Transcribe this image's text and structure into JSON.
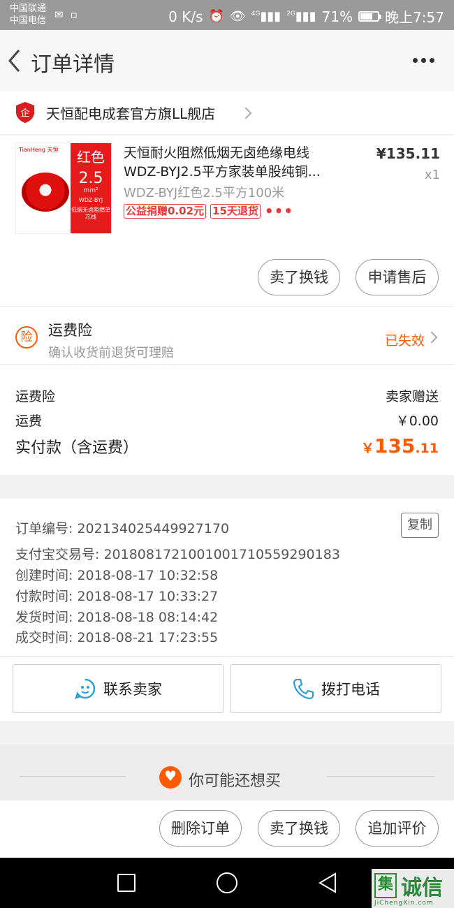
{
  "status_bar": {
    "carrier_1": "中国联通",
    "carrier_2": "中国电信",
    "speed": "0 K/s",
    "net_1": "4G",
    "net_2": "2G",
    "battery": "71%",
    "battery_level": 0.71,
    "time": "晚上7:57"
  },
  "header": {
    "title": "订单详情"
  },
  "store": {
    "name": "天恒配电成套官方旗LL舰店",
    "logo_text": "企"
  },
  "product": {
    "image": {
      "brand": "TianHeng 天恒",
      "color_text": "红色",
      "size_text": "2.5",
      "unit_text": "mm²",
      "model_text": "WDZ-BYJ",
      "desc_text": "低烟无卤阻燃单芯线"
    },
    "title_line1": "天恒耐火阻燃低烟无卤绝缘电线",
    "title_line2": "WDZ-BYJ2.5平方家装单股纯铜...",
    "sku": "WDZ-BYJ红色2.5平方100米",
    "tag_charity": "公益捐赠0.02元",
    "tag_return": "15天退货",
    "tag_more": "•••",
    "price": "¥135.11",
    "quantity": "x1",
    "btn_resell": "卖了换钱",
    "btn_aftersale": "申请售后"
  },
  "insurance": {
    "icon_text": "险",
    "title": "运费险",
    "subtitle": "确认收货前退货可理赔",
    "status": "已失效"
  },
  "costs": {
    "insurance_label": "运费险",
    "insurance_value": "卖家赠送",
    "shipping_label": "运费",
    "shipping_value": "￥0.00",
    "total_label": "实付款（含运费）",
    "total_currency": "￥",
    "total_int": "135",
    "total_dec": ".11"
  },
  "order_info": {
    "order_no": "订单编号: 202134025449927170",
    "copy": "复制",
    "alipay_no": "支付宝交易号: 2018081721001001710559290183",
    "created": "创建时间: 2018-08-17 10:32:58",
    "paid": "付款时间: 2018-08-17 10:33:27",
    "shipped": "发货时间: 2018-08-18 08:14:42",
    "completed": "成交时间: 2018-08-21 17:23:55"
  },
  "contact": {
    "seller": "联系卖家",
    "call": "拨打电话"
  },
  "recommend": {
    "title": "你可能还想买"
  },
  "actions": {
    "delete": "删除订单",
    "resell": "卖了换钱",
    "review": "追加评价"
  },
  "watermark": {
    "logo": "集",
    "text": "诚信",
    "url": "JiChengXin.com"
  },
  "colors": {
    "accent": "#ff5a00",
    "tag_red": "#e4393c",
    "status_bar": "#9a9a9a"
  }
}
